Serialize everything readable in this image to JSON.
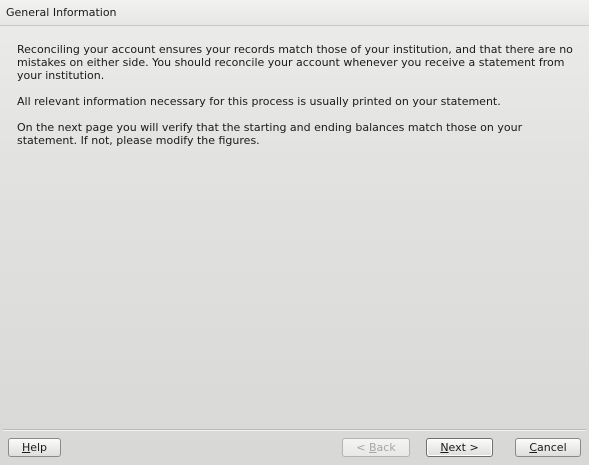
{
  "header": {
    "title": "General Information"
  },
  "content": {
    "paragraphs": [
      "Reconciling your account ensures your records match those of your institution, and that there are no mistakes on either side. You should reconcile your account whenever you receive a statement from your institution.",
      "All relevant information necessary for this process is usually printed on your statement.",
      "On the next page you will verify that the starting and ending balances match those on your statement. If not, please modify the figures."
    ]
  },
  "buttons": {
    "help": {
      "mnemonic": "H",
      "rest": "elp"
    },
    "back": {
      "prefix": "< ",
      "mnemonic": "B",
      "rest": "ack"
    },
    "next": {
      "mnemonic": "N",
      "rest": "ext >"
    },
    "cancel": {
      "mnemonic": "C",
      "rest": "ancel"
    }
  }
}
